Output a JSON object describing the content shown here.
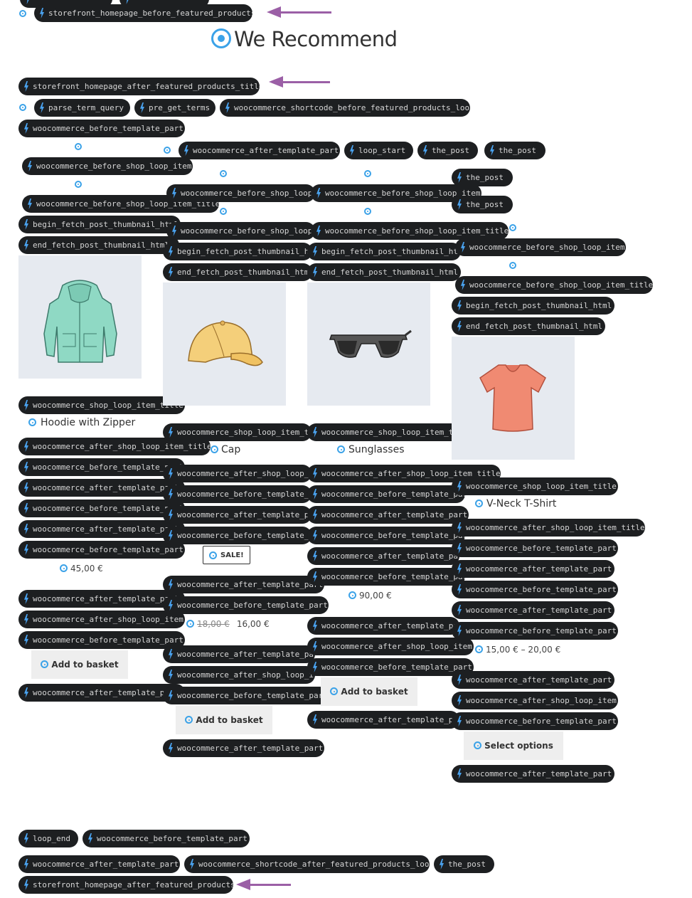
{
  "section": {
    "title": "We Recommend",
    "hooks_top": {
      "before_featured": "storefront_homepage_before_featured_products",
      "after_title": "storefront_homepage_after_featured_products_title",
      "parse_term_query": "parse_term_query",
      "pre_get_terms": "pre_get_terms",
      "before_loop": "woocommerce_shortcode_before_featured_products_loop",
      "before_template_part": "woocommerce_before_template_part",
      "after_template_part": "woocommerce_after_template_part",
      "loop_start": "loop_start",
      "the_post": "the_post"
    },
    "hooks_bottom": {
      "loop_end": "loop_end",
      "before_template_part": "woocommerce_before_template_part",
      "after_template_part": "woocommerce_after_template_part",
      "after_loop": "woocommerce_shortcode_after_featured_products_loop",
      "the_post": "the_post",
      "after_featured": "storefront_homepage_after_featured_products"
    }
  },
  "hook_names": {
    "before_item": "woocommerce_before_shop_loop_item",
    "before_item_title": "woocommerce_before_shop_loop_item_title",
    "begin_thumb": "begin_fetch_post_thumbnail_html",
    "end_thumb": "end_fetch_post_thumbnail_html",
    "item_title": "woocommerce_shop_loop_item_title",
    "after_item_title": "woocommerce_after_shop_loop_item_title",
    "before_tp": "woocommerce_before_template_part",
    "after_tp": "woocommerce_after_template_part",
    "after_item": "woocommerce_after_shop_loop_item",
    "the_post": "the_post"
  },
  "products": [
    {
      "name": "Hoodie with Zipper",
      "price": "45,00 €",
      "button": "Add to basket"
    },
    {
      "name": "Cap",
      "sale_badge": "SALE!",
      "old_price": "18,00 €",
      "price": "16,00 €",
      "button": "Add to basket"
    },
    {
      "name": "Sunglasses",
      "price": "90,00 €",
      "button": "Add to basket"
    },
    {
      "name": "V-Neck T-Shirt",
      "price": "15,00 € – 20,00 €",
      "button": "Select options"
    }
  ],
  "colors": {
    "hook_bg": "#1d1f21",
    "hook_icon": "#4aa3f0",
    "marker": "#3ba2e8",
    "arrow": "#9b5fa6",
    "image_bg": "#e6eaf0",
    "button_bg": "#eeeeee"
  },
  "icons": {
    "hook": "lightning-bolt-icon",
    "marker": "target-dot-icon",
    "arrow": "arrow-left-icon"
  }
}
